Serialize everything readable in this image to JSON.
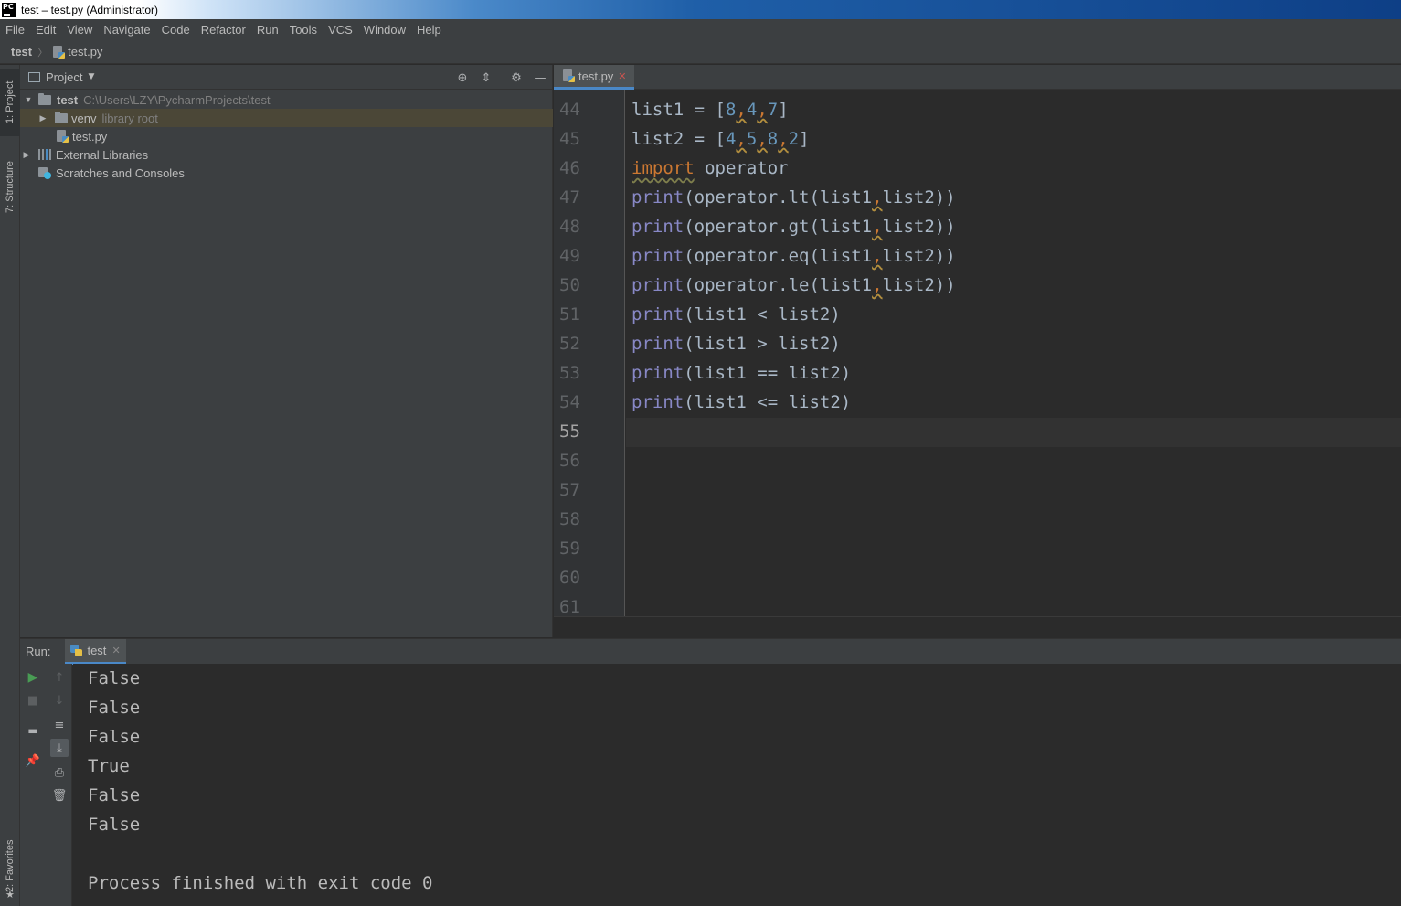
{
  "window": {
    "title": "test – test.py (Administrator)",
    "logo_text": "PC"
  },
  "menu": [
    "File",
    "Edit",
    "View",
    "Navigate",
    "Code",
    "Refactor",
    "Run",
    "Tools",
    "VCS",
    "Window",
    "Help"
  ],
  "breadcrumb": {
    "project": "test",
    "file": "test.py"
  },
  "side_tabs": {
    "project": "1: Project",
    "structure": "7: Structure",
    "favorites": "2: Favorites"
  },
  "project_panel": {
    "title": "Project",
    "tree": [
      {
        "name": "test",
        "hint": "C:\\Users\\LZY\\PycharmProjects\\test"
      },
      {
        "name": "venv",
        "hint": "library root"
      },
      {
        "name": "test.py",
        "hint": ""
      },
      {
        "name": "External Libraries",
        "hint": ""
      },
      {
        "name": "Scratches and Consoles",
        "hint": ""
      }
    ]
  },
  "editor": {
    "tab_label": "test.py",
    "current_line": 55,
    "line_numbers": [
      "44",
      "45",
      "46",
      "47",
      "48",
      "49",
      "50",
      "51",
      "52",
      "53",
      "54",
      "55",
      "56",
      "57",
      "58",
      "59",
      "60",
      "61"
    ],
    "code": {
      "l44": {
        "a": "list1 = [",
        "n1": "8",
        "c1": ",",
        "n2": "4",
        "c2": ",",
        "n3": "7",
        "b": "]"
      },
      "l45": {
        "a": "list2 = [",
        "n1": "4",
        "c1": ",",
        "n2": "5",
        "c2": ",",
        "n3": "8",
        "c3": ",",
        "n4": "2",
        "b": "]"
      },
      "l46": {
        "kw": "import",
        "rest": " operator"
      },
      "l47": {
        "fn": "print",
        "a": "(operator.lt(list1",
        "c": ",",
        "b": "list2))"
      },
      "l48": {
        "fn": "print",
        "a": "(operator.gt(list1",
        "c": ",",
        "b": "list2))"
      },
      "l49": {
        "fn": "print",
        "a": "(operator.eq(list1",
        "c": ",",
        "b": "list2))"
      },
      "l50": {
        "fn": "print",
        "a": "(operator.le(list1",
        "c": ",",
        "b": "list2))"
      },
      "l51": {
        "fn": "print",
        "a": "(list1 < list2)"
      },
      "l52": {
        "fn": "print",
        "a": "(list1 > list2)"
      },
      "l53": {
        "fn": "print",
        "a": "(list1 == list2)"
      },
      "l54": {
        "fn": "print",
        "a": "(list1 <= list2)"
      }
    }
  },
  "run_panel": {
    "label": "Run:",
    "tab_label": "test",
    "output": [
      "False",
      "False",
      "False",
      "True",
      "False",
      "False",
      "",
      "Process finished with exit code 0"
    ]
  },
  "colors": {
    "accent": "#4a88c7",
    "keyword": "#cc7832",
    "number": "#6897bb",
    "builtin": "#8888c6",
    "text": "#a9b7c6",
    "run_green": "#499c54"
  }
}
